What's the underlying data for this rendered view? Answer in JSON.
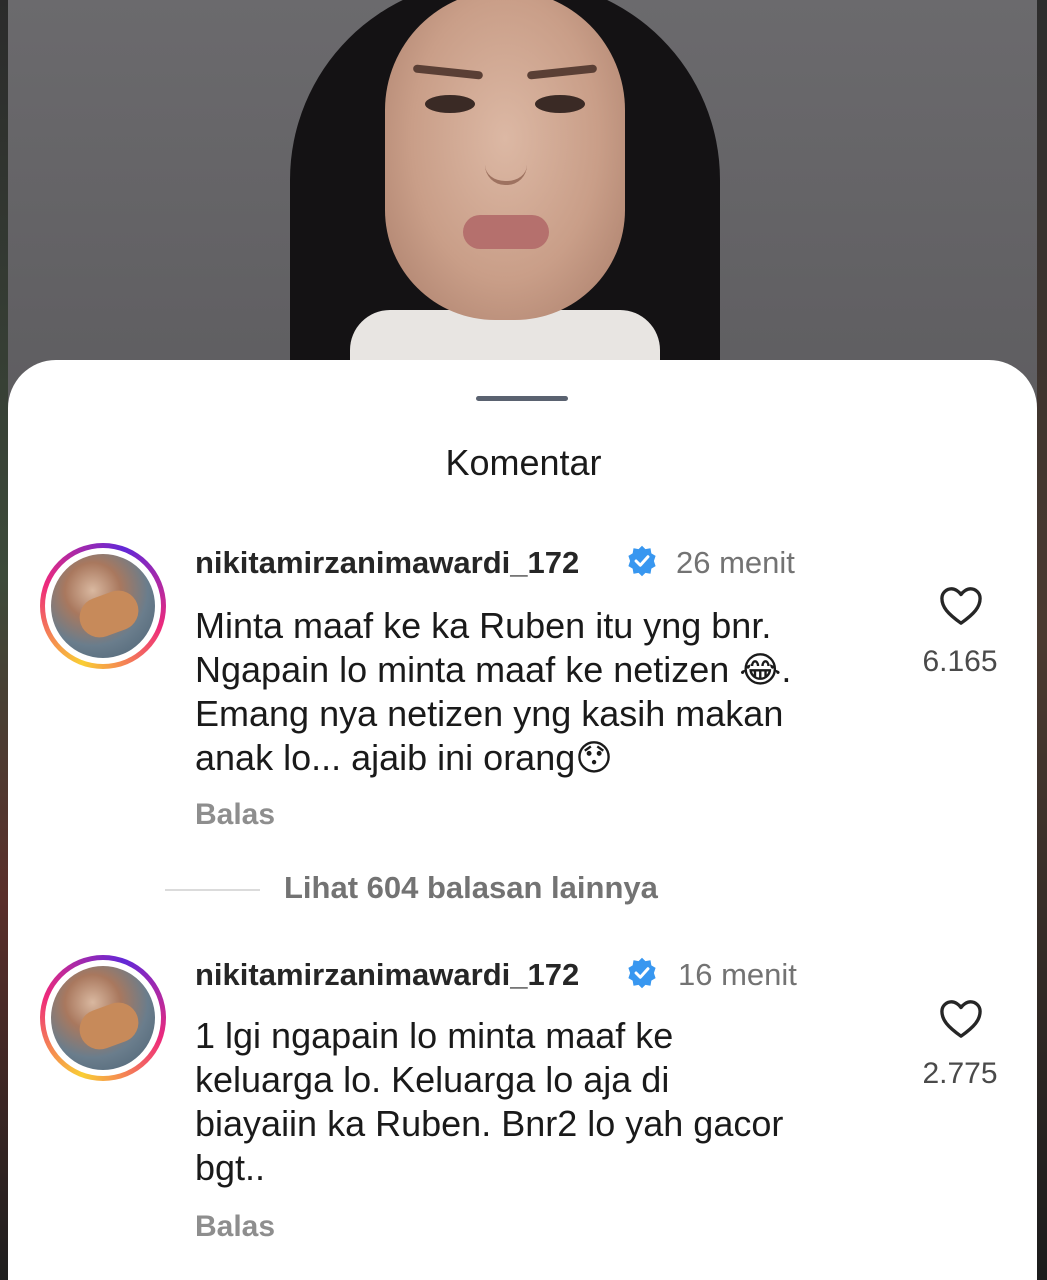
{
  "sheet": {
    "title": "Komentar"
  },
  "comments": [
    {
      "username": "nikitamirzanimawardi_172",
      "verified": true,
      "time": "26 menit",
      "text": "Minta maaf ke ka Ruben itu yng bnr.\nNgapain lo minta maaf ke netizen 😂.\nEmang nya netizen yng kasih makan\nanak lo... ajaib ini orang😯",
      "reply_label": "Balas",
      "likes": "6.165"
    },
    {
      "username": "nikitamirzanimawardi_172",
      "verified": true,
      "time": "16 menit",
      "text": "1 lgi ngapain lo minta maaf ke\nkeluarga lo. Keluarga lo aja di\nbiayaiin ka Ruben. Bnr2 lo yah gacor\nbgt..",
      "reply_label": "Balas",
      "likes": "2.775"
    }
  ],
  "view_more_replies": "Lihat 604 balasan lainnya",
  "colors": {
    "verified_blue": "#3897f0",
    "username": "#262626",
    "muted": "#737373"
  }
}
